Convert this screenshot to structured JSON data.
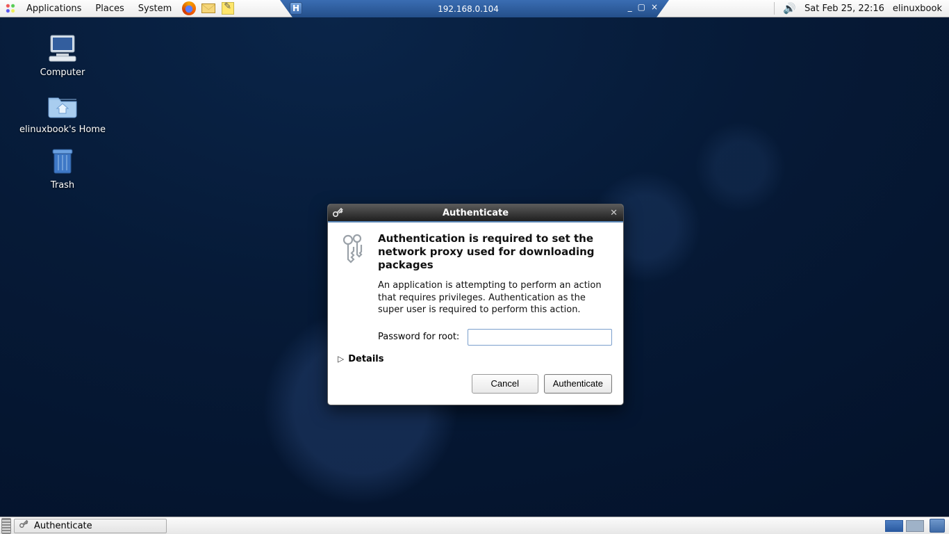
{
  "top_panel": {
    "menus": {
      "applications": "Applications",
      "places": "Places",
      "system": "System"
    },
    "title": "192.168.0.104",
    "clock": "Sat Feb 25, 22:16",
    "user": "elinuxbook",
    "title_icon_char": "H"
  },
  "desktop_icons": {
    "computer": "Computer",
    "home": "elinuxbook's Home",
    "trash": "Trash"
  },
  "dialog": {
    "title": "Authenticate",
    "heading": "Authentication is required to set the network proxy used for downloading packages",
    "description": "An application is attempting to perform an action that requires privileges. Authentication as the super user is required to perform this action.",
    "password_label": "Password for root:",
    "password_value": "",
    "details_label": "Details",
    "cancel": "Cancel",
    "authenticate": "Authenticate"
  },
  "bottom_panel": {
    "task_label": "Authenticate"
  }
}
